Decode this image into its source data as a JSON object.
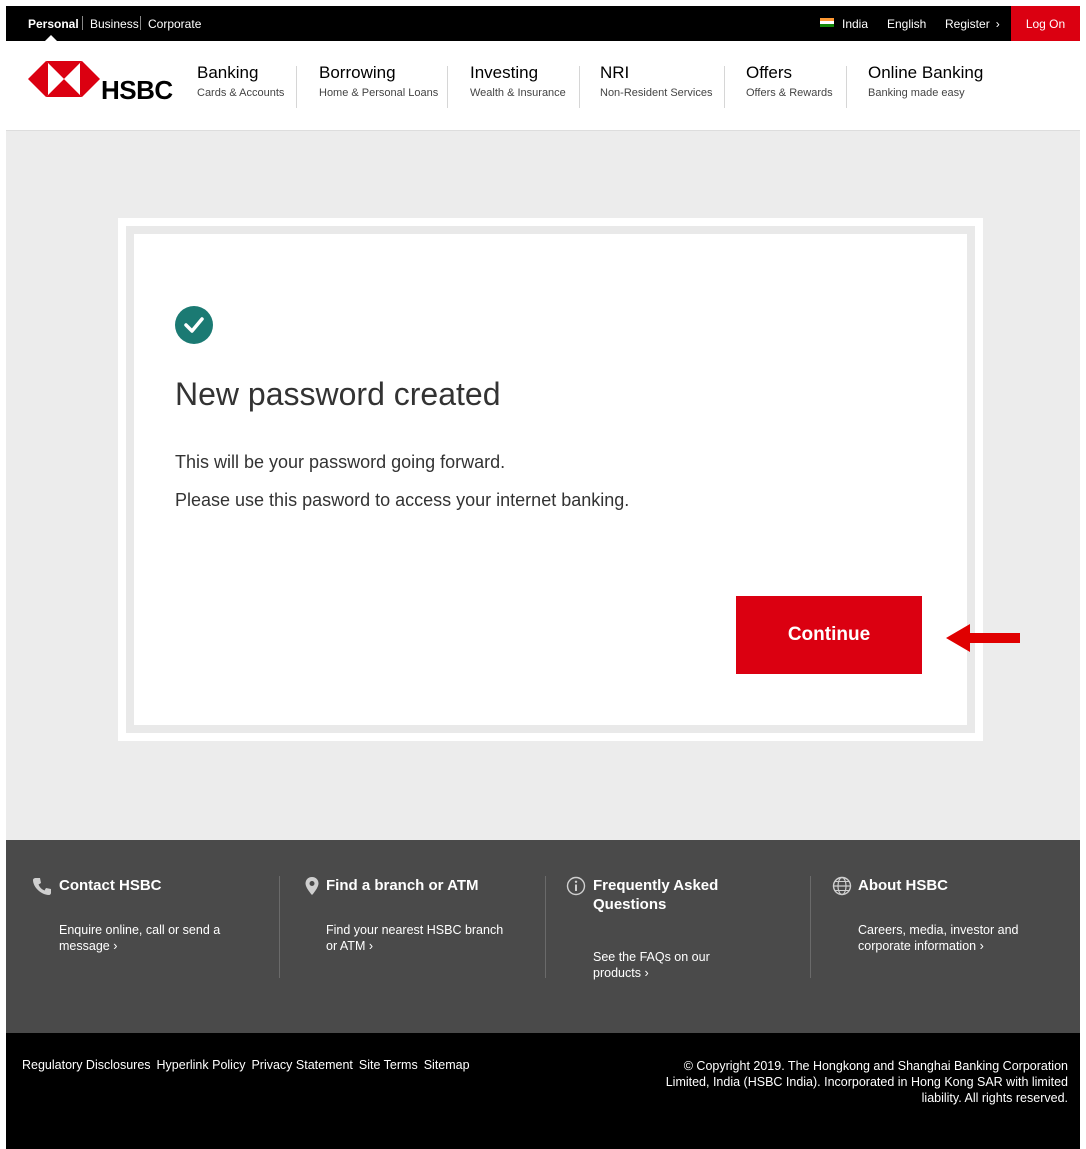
{
  "topbar": {
    "segments": [
      "Personal",
      "Business",
      "Corporate"
    ],
    "country": "India",
    "language": "English",
    "register": "Register",
    "logon": "Log On"
  },
  "header": {
    "brand": "HSBC",
    "nav": [
      {
        "title": "Banking",
        "sub": "Cards & Accounts"
      },
      {
        "title": "Borrowing",
        "sub": "Home & Personal Loans"
      },
      {
        "title": "Investing",
        "sub": "Wealth & Insurance"
      },
      {
        "title": "NRI",
        "sub": "Non-Resident Services"
      },
      {
        "title": "Offers",
        "sub": "Offers & Rewards"
      },
      {
        "title": "Online Banking",
        "sub": "Banking made easy"
      }
    ]
  },
  "card": {
    "title": "New password created",
    "line1": "This will be your password going forward.",
    "line2": "Please use this pasword to access your internet banking.",
    "continue": "Continue"
  },
  "footer": {
    "contact": {
      "title": "Contact HSBC",
      "text1": "Enquire online, call or send a",
      "text2": "message"
    },
    "branch": {
      "title": "Find a branch or ATM",
      "text1": "Find your nearest HSBC branch",
      "text2": "or ATM"
    },
    "faq": {
      "title1": "Frequently Asked",
      "title2": "Questions",
      "text1": "See the FAQs on our",
      "text2": "products"
    },
    "about": {
      "title": "About HSBC",
      "text1": "Careers, media, investor and",
      "text2": "corporate information"
    }
  },
  "bottom": {
    "links": [
      "Regulatory Disclosures",
      "Hyperlink Policy",
      "Privacy Statement",
      "Site Terms",
      "Sitemap"
    ],
    "copyright1": "© Copyright 2019. The Hongkong and Shanghai Banking Corporation",
    "copyright2": "Limited, India (HSBC India). Incorporated in Hong Kong SAR with limited",
    "copyright3": "liability. All rights reserved."
  },
  "colors": {
    "brand_red": "#db0011",
    "success_teal": "#1b7a73",
    "footer_grey": "#4a4a4a"
  }
}
